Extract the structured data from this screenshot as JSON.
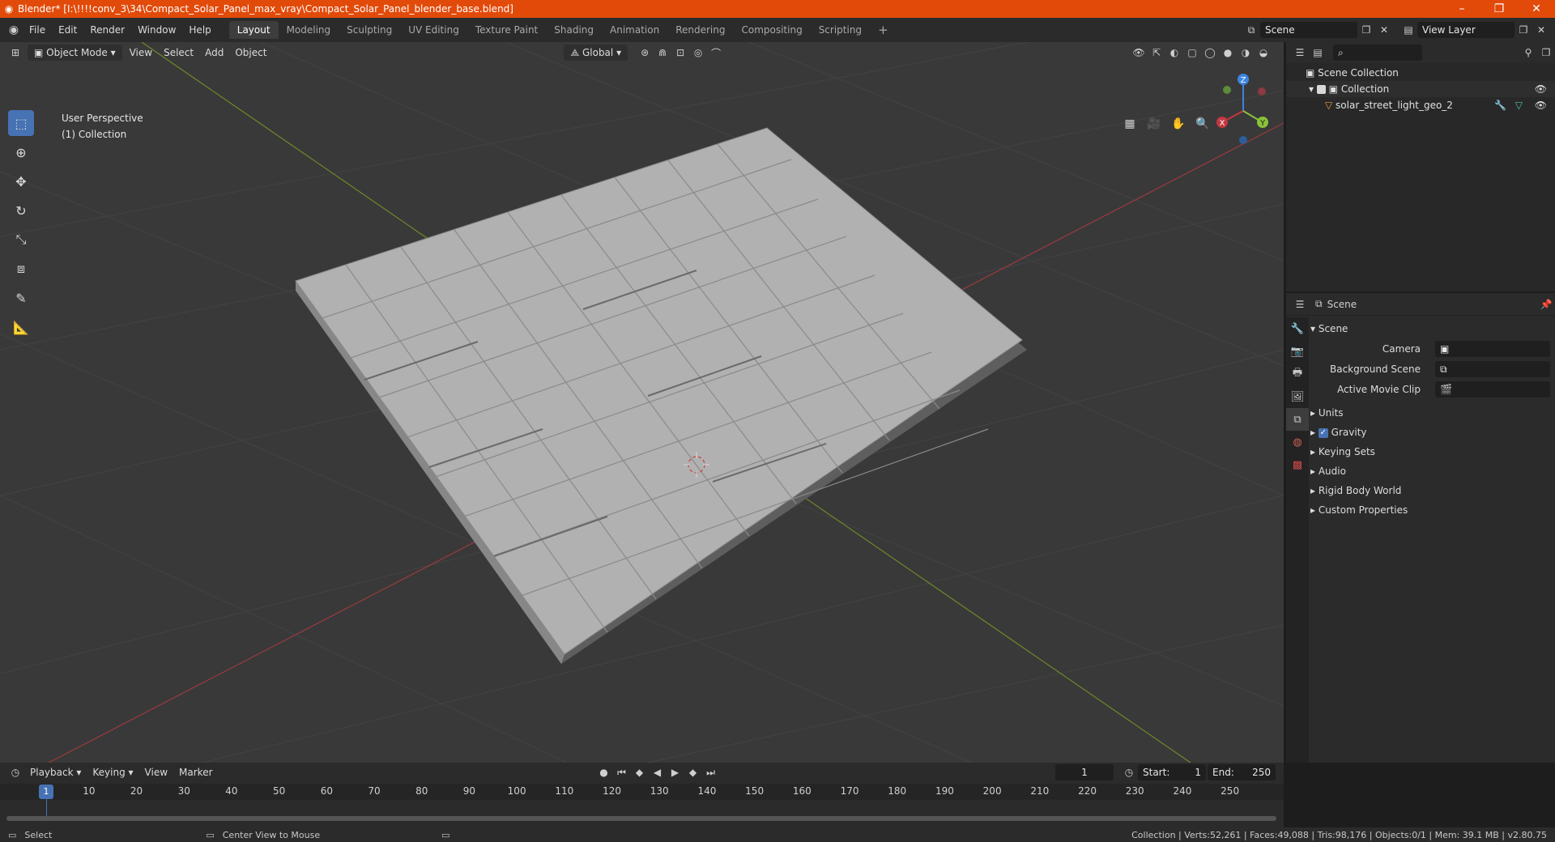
{
  "titlebar": {
    "title": "Blender* [I:\\!!!!conv_3\\34\\Compact_Solar_Panel_max_vray\\Compact_Solar_Panel_blender_base.blend]",
    "minimize": "–",
    "maximize": "❐",
    "close": "✕"
  },
  "menu": [
    "File",
    "Edit",
    "Render",
    "Window",
    "Help"
  ],
  "workspaces": [
    "Layout",
    "Modeling",
    "Sculpting",
    "UV Editing",
    "Texture Paint",
    "Shading",
    "Animation",
    "Rendering",
    "Compositing",
    "Scripting"
  ],
  "active_workspace": "Layout",
  "add_workspace": "+",
  "scene_field": "Scene",
  "view_layer_field": "View Layer",
  "viewport": {
    "mode": "Object Mode",
    "menus": [
      "View",
      "Select",
      "Add",
      "Object"
    ],
    "transform_orientation": "Global",
    "info_line1": "User Perspective",
    "info_line2": "(1) Collection",
    "gizmo_labels": {
      "z": "Z",
      "x": "X",
      "y": "Y"
    }
  },
  "outliner": {
    "root": "Scene Collection",
    "collection": "Collection",
    "object": "solar_street_light_geo_2"
  },
  "properties": {
    "context": "Scene",
    "panel_title": "Scene",
    "camera_label": "Camera",
    "background_scene_label": "Background Scene",
    "active_movie_clip_label": "Active Movie Clip",
    "panels": [
      "Units",
      "Gravity",
      "Keying Sets",
      "Audio",
      "Rigid Body World",
      "Custom Properties"
    ],
    "gravity_checked": true
  },
  "timeline": {
    "menus": [
      "Playback",
      "Keying",
      "View",
      "Marker"
    ],
    "current_frame": "1",
    "start_label": "Start:",
    "start_value": "1",
    "end_label": "End:",
    "end_value": "250",
    "frame_ticks": [
      "1",
      "10",
      "20",
      "30",
      "40",
      "50",
      "60",
      "70",
      "80",
      "90",
      "100",
      "110",
      "120",
      "130",
      "140",
      "150",
      "160",
      "170",
      "180",
      "190",
      "200",
      "210",
      "220",
      "230",
      "240",
      "250"
    ]
  },
  "statusbar": {
    "select": "Select",
    "center_view": "Center View to Mouse",
    "stats": "Collection | Verts:52,261 | Faces:49,088 | Tris:98,176 | Objects:0/1 | Mem: 39.1 MB | v2.80.75"
  },
  "colors": {
    "titlebar": "#e24a0a",
    "accent": "#4772b3",
    "x_axis": "#c3373f",
    "y_axis": "#8ac13a",
    "z_axis": "#3c85e0"
  }
}
